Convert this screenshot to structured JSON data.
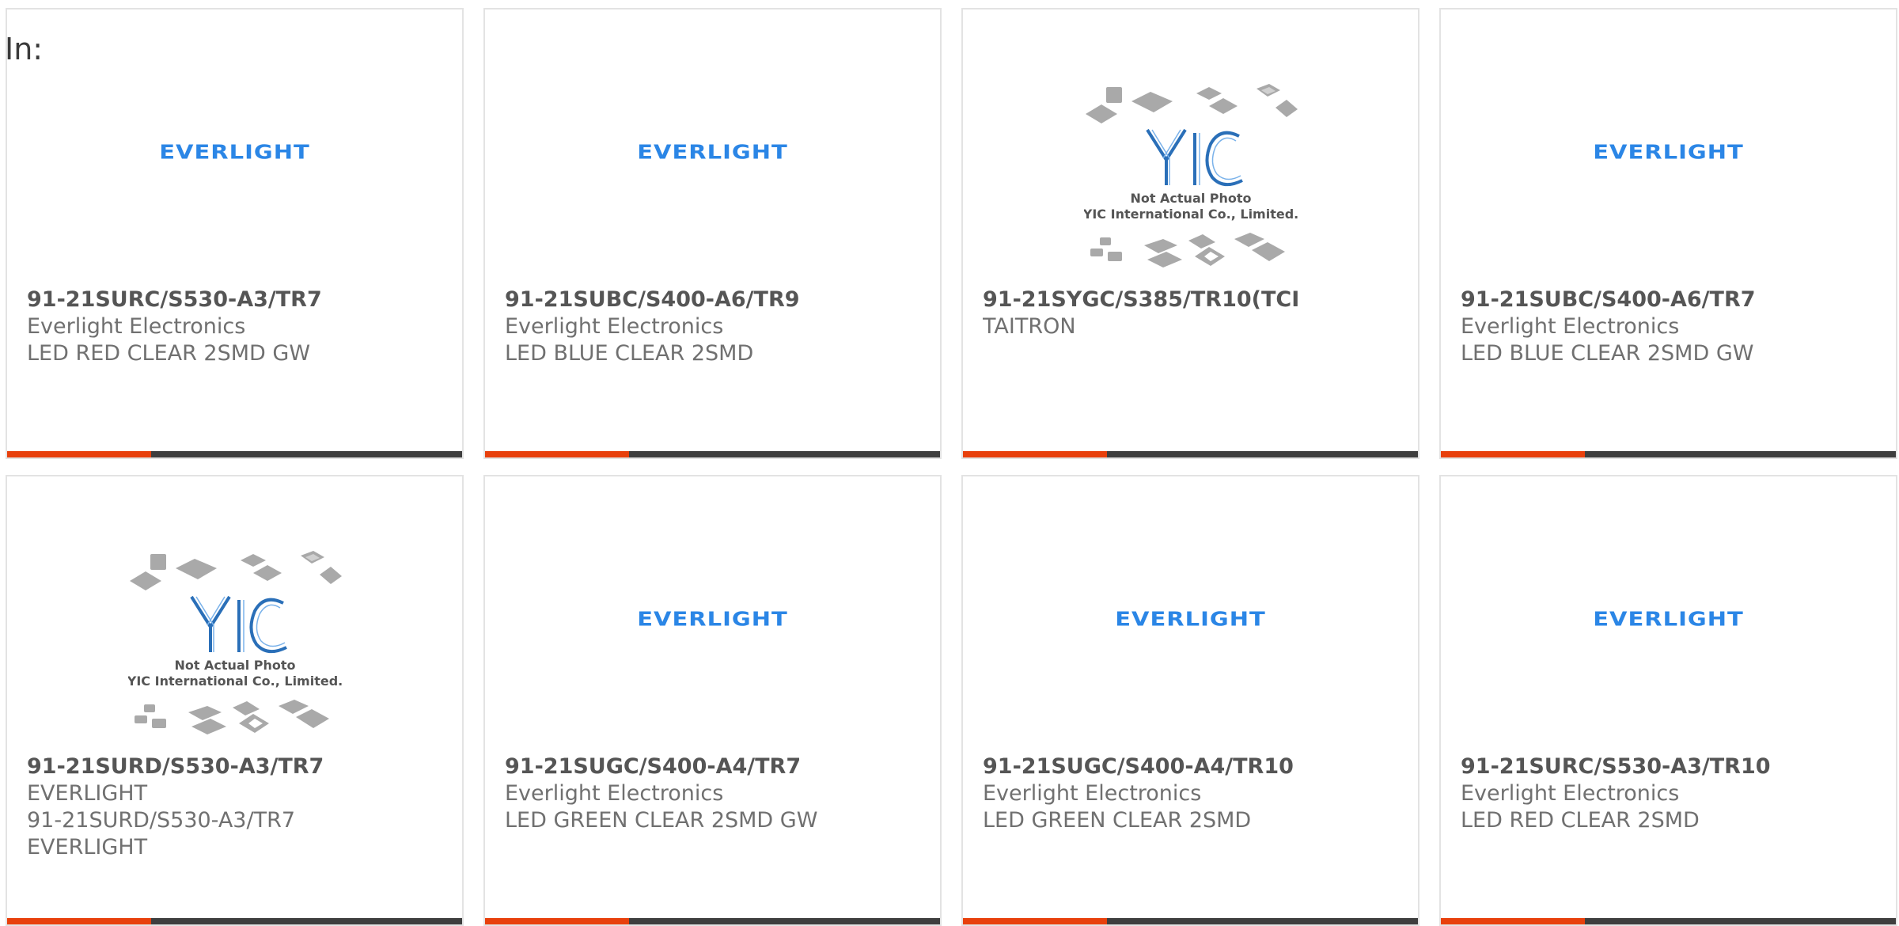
{
  "header": {
    "in_label": "In:"
  },
  "colors": {
    "accent": "#e8400c",
    "bar": "#3e3e3e",
    "logo_blue": "#2b86e6"
  },
  "cards": [
    {
      "logo": "EVERLIGHT",
      "part": "91-21SURC/S530-A3/TR7",
      "lines": [
        "Everlight Electronics",
        "LED RED CLEAR 2SMD GW"
      ]
    },
    {
      "logo": "EVERLIGHT",
      "part": "91-21SUBC/S400-A6/TR9",
      "lines": [
        "Everlight Electronics",
        "LED BLUE CLEAR 2SMD"
      ]
    },
    {
      "logo": "YIC",
      "yic_lines": [
        "Not Actual Photo",
        "YIC International Co., Limited."
      ],
      "part": "91-21SYGC/S385/TR10(TCI",
      "lines": [
        "TAITRON"
      ]
    },
    {
      "logo": "EVERLIGHT",
      "part": "91-21SUBC/S400-A6/TR7",
      "lines": [
        "Everlight Electronics",
        "LED BLUE CLEAR 2SMD GW"
      ]
    },
    {
      "logo": "YIC",
      "yic_lines": [
        "Not Actual Photo",
        "YIC International Co., Limited."
      ],
      "part": "91-21SURD/S530-A3/TR7",
      "lines": [
        "EVERLIGHT",
        "91-21SURD/S530-A3/TR7",
        "EVERLIGHT"
      ]
    },
    {
      "logo": "EVERLIGHT",
      "part": "91-21SUGC/S400-A4/TR7",
      "lines": [
        "Everlight Electronics",
        "LED GREEN CLEAR 2SMD GW"
      ]
    },
    {
      "logo": "EVERLIGHT",
      "part": "91-21SUGC/S400-A4/TR10",
      "lines": [
        "Everlight Electronics",
        "LED GREEN CLEAR 2SMD"
      ]
    },
    {
      "logo": "EVERLIGHT",
      "part": "91-21SURC/S530-A3/TR10",
      "lines": [
        "Everlight Electronics",
        "LED RED CLEAR 2SMD"
      ]
    }
  ]
}
